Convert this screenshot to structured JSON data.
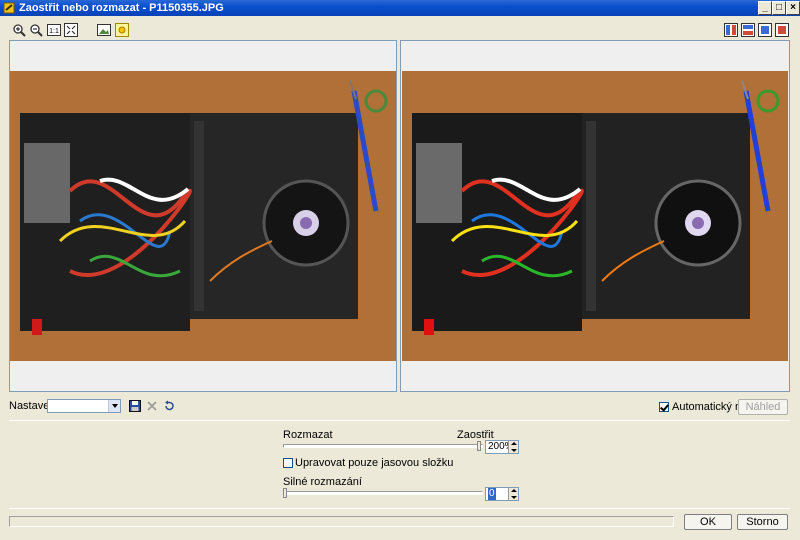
{
  "window": {
    "title": "Zaostřit nebo rozmazat - P1150355.JPG",
    "minimize": "_",
    "maximize": "□",
    "close": "×"
  },
  "toolbar": {
    "left_icons": [
      "zoom-in-icon",
      "zoom-out-icon",
      "actual-size-icon",
      "fit-to-window-icon",
      "image-icon",
      "sun-icon"
    ],
    "actual_size_label": "1:1",
    "right_icons": [
      "split-vertical-icon",
      "split-horizontal-icon",
      "single-preview-icon",
      "original-only-icon"
    ]
  },
  "preset": {
    "label": "Nastavení:",
    "value": ""
  },
  "auto_preview": {
    "label": "Automatický náhled",
    "checked": true
  },
  "preview_button": {
    "label": "Náhled"
  },
  "sharpen": {
    "left_label": "Rozmazat",
    "right_label": "Zaostřit",
    "value": "200%",
    "level": 1.0
  },
  "luminance_only": {
    "label": "Upravovat pouze jasovou složku",
    "checked": false
  },
  "strong_blur": {
    "label": "Silné rozmazání",
    "value": "0",
    "level": 0.0
  },
  "ok_button": {
    "label": "OK"
  },
  "cancel_button": {
    "label": "Storno"
  },
  "colors": {
    "accent": "#0a4fcf",
    "wood": "#b8763c",
    "case": "#1f1f1f"
  }
}
